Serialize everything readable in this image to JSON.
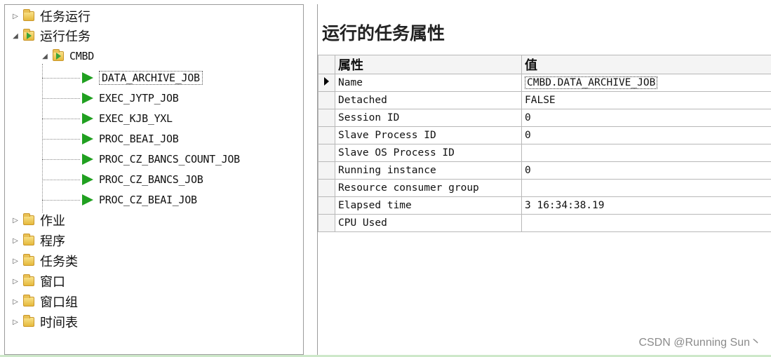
{
  "tree": {
    "top_nodes": [
      {
        "label": "任务运行",
        "expanded": false
      },
      {
        "label": "运行任务",
        "expanded": true
      }
    ],
    "group": {
      "label": "CMBD",
      "expanded": true
    },
    "jobs": [
      {
        "label": "DATA_ARCHIVE_JOB",
        "selected": true
      },
      {
        "label": "EXEC_JYTP_JOB"
      },
      {
        "label": "EXEC_KJB_YXL"
      },
      {
        "label": "PROC_BEAI_JOB"
      },
      {
        "label": "PROC_CZ_BANCS_COUNT_JOB"
      },
      {
        "label": "PROC_CZ_BANCS_JOB"
      },
      {
        "label": "PROC_CZ_BEAI_JOB"
      }
    ],
    "bottom_nodes": [
      {
        "label": "作业"
      },
      {
        "label": "程序"
      },
      {
        "label": "任务类"
      },
      {
        "label": "窗口"
      },
      {
        "label": "窗口组"
      },
      {
        "label": "时间表"
      }
    ]
  },
  "props": {
    "title": "运行的任务属性",
    "col_attr": "属性",
    "col_val": "值",
    "rows": [
      {
        "attr": "Name",
        "value": "CMBD.DATA_ARCHIVE_JOB",
        "current": true
      },
      {
        "attr": "Detached",
        "value": "FALSE"
      },
      {
        "attr": "Session ID",
        "value": "0"
      },
      {
        "attr": "Slave Process ID",
        "value": "0"
      },
      {
        "attr": "Slave OS Process ID",
        "value": ""
      },
      {
        "attr": "Running instance",
        "value": "0"
      },
      {
        "attr": "Resource consumer group",
        "value": ""
      },
      {
        "attr": "Elapsed time",
        "value": "3 16:34:38.19"
      },
      {
        "attr": "CPU Used",
        "value": ""
      }
    ]
  },
  "watermark": "CSDN @Running Sun丶"
}
